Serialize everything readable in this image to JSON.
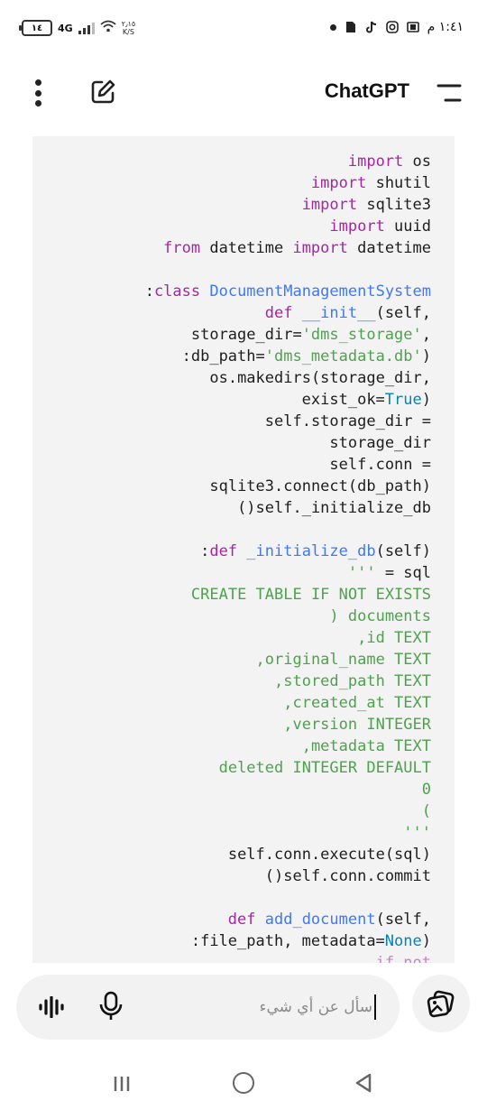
{
  "status_bar": {
    "battery": "١٤",
    "network": "4G",
    "speed_value": "٢٫١٥",
    "speed_unit": "K/S",
    "time": "١:٤١ م"
  },
  "header": {
    "title": "ChatGPT",
    "icons": [
      "more-vert-icon",
      "edit-icon",
      "menu-icon"
    ]
  },
  "code_lines": [
    [
      {
        "t": "import",
        "c": "kw"
      },
      {
        "t": " os",
        "c": ""
      }
    ],
    [
      {
        "t": "import",
        "c": "kw"
      },
      {
        "t": " shutil",
        "c": ""
      }
    ],
    [
      {
        "t": "import",
        "c": "kw"
      },
      {
        "t": " sqlite3",
        "c": ""
      }
    ],
    [
      {
        "t": "import",
        "c": "kw"
      },
      {
        "t": " uuid",
        "c": ""
      }
    ],
    [
      {
        "t": "from",
        "c": "kw"
      },
      {
        "t": " datetime ",
        "c": ""
      },
      {
        "t": "import",
        "c": "kw"
      },
      {
        "t": " datetime",
        "c": ""
      }
    ],
    [],
    [
      {
        "t": ":",
        "c": ""
      },
      {
        "t": "class",
        "c": "kw"
      },
      {
        "t": " DocumentManagementSystem",
        "c": "fn"
      }
    ],
    [
      {
        "t": "def",
        "c": "kw"
      },
      {
        "t": " __init__",
        "c": "fn"
      },
      {
        "t": "(self,",
        "c": ""
      }
    ],
    [
      {
        "t": "storage_dir=",
        "c": ""
      },
      {
        "t": "'dms_storage'",
        "c": "str"
      },
      {
        "t": ",",
        "c": ""
      }
    ],
    [
      {
        "t": ":db_path=",
        "c": ""
      },
      {
        "t": "'dms_metadata.db'",
        "c": "str"
      },
      {
        "t": ")",
        "c": ""
      }
    ],
    [
      {
        "t": "os.makedirs(storage_dir,",
        "c": ""
      }
    ],
    [
      {
        "t": "exist_ok=",
        "c": ""
      },
      {
        "t": "True",
        "c": "bool"
      },
      {
        "t": ")",
        "c": ""
      }
    ],
    [
      {
        "t": "self.storage_dir =",
        "c": ""
      }
    ],
    [
      {
        "t": "storage_dir",
        "c": ""
      }
    ],
    [
      {
        "t": "self.conn =",
        "c": ""
      }
    ],
    [
      {
        "t": "sqlite3.connect(db_path)",
        "c": ""
      }
    ],
    [
      {
        "t": "()self._initialize_db",
        "c": ""
      }
    ],
    [],
    [
      {
        "t": ":",
        "c": ""
      },
      {
        "t": "def",
        "c": "kw"
      },
      {
        "t": " _initialize_db",
        "c": "fn"
      },
      {
        "t": "(self)",
        "c": ""
      }
    ],
    [
      {
        "t": "'''",
        "c": "grn"
      },
      {
        "t": " = sql",
        "c": ""
      }
    ],
    [
      {
        "t": "CREATE TABLE IF NOT EXISTS",
        "c": "grn"
      }
    ],
    [
      {
        "t": ") documents",
        "c": "grn"
      }
    ],
    [
      {
        "t": ",id TEXT",
        "c": "grn"
      }
    ],
    [
      {
        "t": ",original_name TEXT",
        "c": "grn"
      }
    ],
    [
      {
        "t": ",stored_path TEXT",
        "c": "grn"
      }
    ],
    [
      {
        "t": ",created_at TEXT",
        "c": "grn"
      }
    ],
    [
      {
        "t": ",version INTEGER",
        "c": "grn"
      }
    ],
    [
      {
        "t": ",metadata TEXT",
        "c": "grn"
      }
    ],
    [
      {
        "t": "deleted INTEGER DEFAULT",
        "c": "grn"
      }
    ],
    [
      {
        "t": "0",
        "c": "grn"
      }
    ],
    [
      {
        "t": "(",
        "c": "grn"
      }
    ],
    [
      {
        "t": "'''",
        "c": "grn"
      }
    ],
    [
      {
        "t": "self.conn.execute(sql)",
        "c": ""
      }
    ],
    [
      {
        "t": "()self.conn.commit",
        "c": ""
      }
    ],
    [],
    [
      {
        "t": "def",
        "c": "kw"
      },
      {
        "t": " add_document",
        "c": "fn"
      },
      {
        "t": "(self,",
        "c": ""
      }
    ],
    [
      {
        "t": ":file_path, metadata=",
        "c": ""
      },
      {
        "t": "None",
        "c": "bool"
      },
      {
        "t": ")",
        "c": ""
      }
    ],
    [
      {
        "t": "if not",
        "c": "kw"
      }
    ]
  ],
  "input": {
    "placeholder": "سأل عن أي شيء"
  },
  "bottom_icons": [
    "voice-mode-icon",
    "microphone-icon",
    "image-upload-icon"
  ],
  "nav_icons": [
    "recent-apps-icon",
    "home-icon",
    "back-icon"
  ]
}
